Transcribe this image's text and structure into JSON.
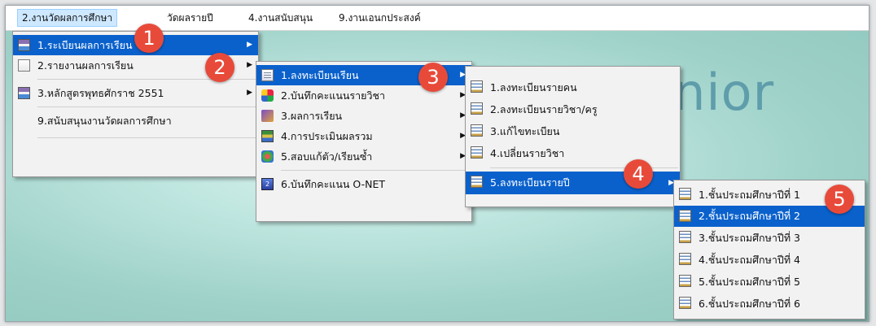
{
  "menubar": {
    "items": [
      {
        "label": "2.งานวัดผลการศึกษา"
      },
      {
        "label": "วัดผลรายปี"
      },
      {
        "label": "4.งานสนับสนุน"
      },
      {
        "label": "9.งานเอนกประสงค์"
      }
    ]
  },
  "background": {
    "text": "'2551 Junior"
  },
  "menu1": {
    "items": [
      {
        "label": "1.ระเบียนผลการเรียน",
        "icon": "book-icon"
      },
      {
        "label": "2.รายงานผลการเรียน",
        "icon": "document-icon"
      },
      {
        "label": "3.หลักสูตรพุทธศักราช 2551",
        "icon": "books-icon"
      },
      {
        "label": "9.สนับสนุนงานวัดผลการศึกษา"
      }
    ]
  },
  "menu2": {
    "items": [
      {
        "label": "1.ลงทะเบียนเรียน"
      },
      {
        "label": "2.บันทึกคะแนนรายวิชา"
      },
      {
        "label": "3.ผลการเรียน"
      },
      {
        "label": "4.การประเมินผลรวม"
      },
      {
        "label": "5.สอบแก้ตัว/เรียนซ้ำ"
      },
      {
        "label": "6.บันทึกคะแนน O-NET"
      }
    ]
  },
  "menu3": {
    "items": [
      {
        "label": "1.ลงทะเบียนรายคน"
      },
      {
        "label": "2.ลงทะเบียนรายวิชา/ครู"
      },
      {
        "label": "3.แก้ไขทะเบียน"
      },
      {
        "label": "4.เปลี่ยนรายวิชา"
      },
      {
        "label": "5.ลงทะเบียนรายปี"
      }
    ]
  },
  "menu4": {
    "items": [
      {
        "label": "1.ชั้นประถมศึกษาปีที่ 1"
      },
      {
        "label": "2.ชั้นประถมศึกษาปีที่ 2"
      },
      {
        "label": "3.ชั้นประถมศึกษาปีที่ 3"
      },
      {
        "label": "4.ชั้นประถมศึกษาปีที่ 4"
      },
      {
        "label": "5.ชั้นประถมศึกษาปีที่ 5"
      },
      {
        "label": "6.ชั้นประถมศึกษาปีที่ 6"
      }
    ]
  },
  "badges": [
    "1",
    "2",
    "3",
    "4",
    "5"
  ],
  "colors": {
    "badge": "#e84a3a",
    "selection": "#0a61cc",
    "menubar_active": "#cde8ff"
  }
}
